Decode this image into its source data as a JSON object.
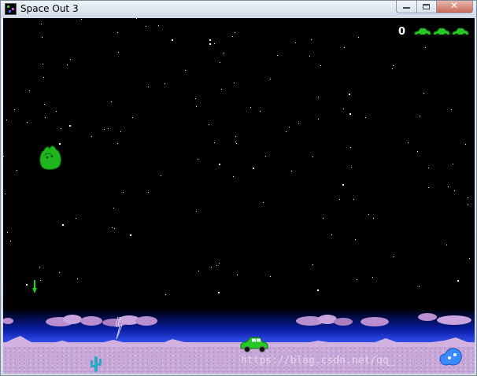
{
  "window": {
    "title": "Space Out 3",
    "close_glyph": "✕"
  },
  "hud": {
    "score": "0",
    "lives_remaining": 3,
    "life_icon": "green-car-icon"
  },
  "sprites": {
    "alien": "green-blob-alien",
    "player": "green-car",
    "missile": "green-missile",
    "scenery": [
      "purple-clouds",
      "lightning-bolt",
      "cactus",
      "blue-blob-alien",
      "purple-mountains"
    ]
  },
  "watermark": "https://blog.csdn.net/qq_",
  "colors": {
    "space": "#000000",
    "horizon": "#2a45e0",
    "ground": "#c8a8d8",
    "alien": "#1fc21f",
    "car": "#25c825",
    "cloud": "#b98fcf"
  }
}
